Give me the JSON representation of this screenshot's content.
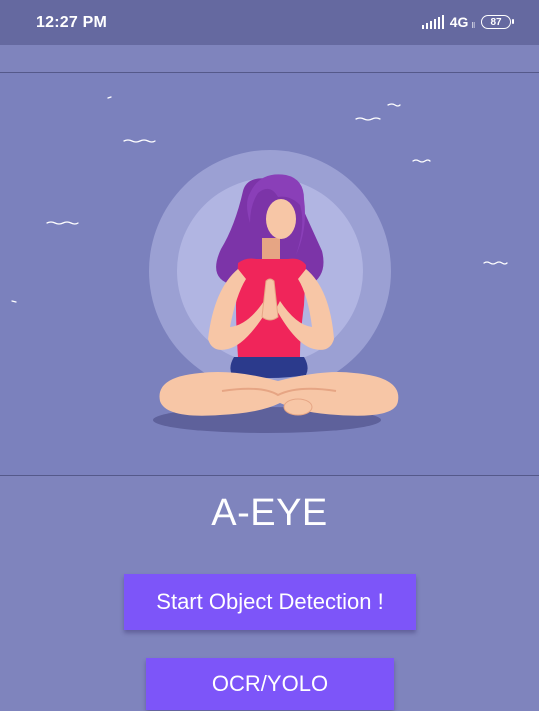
{
  "status_bar": {
    "time": "12:27 PM",
    "network": "4G",
    "network_sub": "ll",
    "battery": "87"
  },
  "hero": {
    "illustration": "woman-meditating-illustration"
  },
  "app": {
    "title": "A-EYE"
  },
  "buttons": {
    "start_object_detection": "Start Object Detection !",
    "ocr_yolo": "OCR/YOLO"
  },
  "colors": {
    "background": "#7f84bd",
    "status_bar": "#6569a0",
    "button": "#7d55f9"
  }
}
